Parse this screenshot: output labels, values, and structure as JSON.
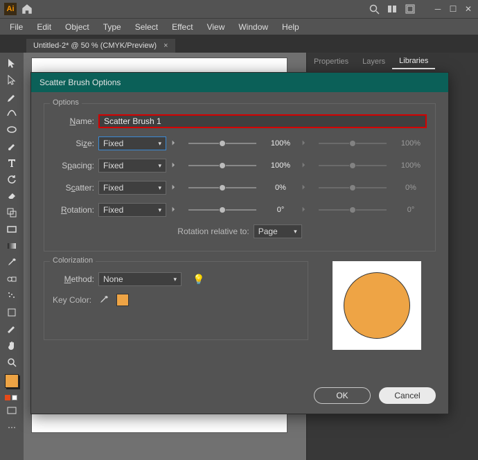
{
  "menuBar": {
    "items": [
      "File",
      "Edit",
      "Object",
      "Type",
      "Select",
      "Effect",
      "View",
      "Window",
      "Help"
    ]
  },
  "documentTab": {
    "title": "Untitled-2* @ 50 % (CMYK/Preview)",
    "close": "×"
  },
  "rightPanel": {
    "tabs": [
      "Properties",
      "Layers",
      "Libraries"
    ],
    "activeIndex": 2
  },
  "dialog": {
    "title": "Scatter Brush Options",
    "options": {
      "group_label": "Options",
      "name_label": "Name:",
      "name_u": "N",
      "name_value": "Scatter Brush 1",
      "size_label": "Size:",
      "size_u": "z",
      "size_mode": "Fixed",
      "size_value": "100%",
      "size_value2": "100%",
      "spacing_label": "Spacing:",
      "spacing_u": "p",
      "spacing_mode": "Fixed",
      "spacing_value": "100%",
      "spacing_value2": "100%",
      "scatter_label": "Scatter:",
      "scatter_u": "c",
      "scatter_mode": "Fixed",
      "scatter_value": "0%",
      "scatter_value2": "0%",
      "rotation_label": "Rotation:",
      "rotation_u": "R",
      "rotation_mode": "Fixed",
      "rotation_value": "0°",
      "rotation_value2": "0°",
      "rotation_relative_label": "Rotation relative to:",
      "rotation_relative_value": "Page"
    },
    "colorization": {
      "group_label": "Colorization",
      "method_label": "Method:",
      "method_u": "M",
      "method_value": "None",
      "key_color_label": "Key Color:",
      "key_color_hex": "#eea445"
    },
    "preview_color": "#eea445",
    "buttons": {
      "ok": "OK",
      "cancel": "Cancel"
    }
  }
}
